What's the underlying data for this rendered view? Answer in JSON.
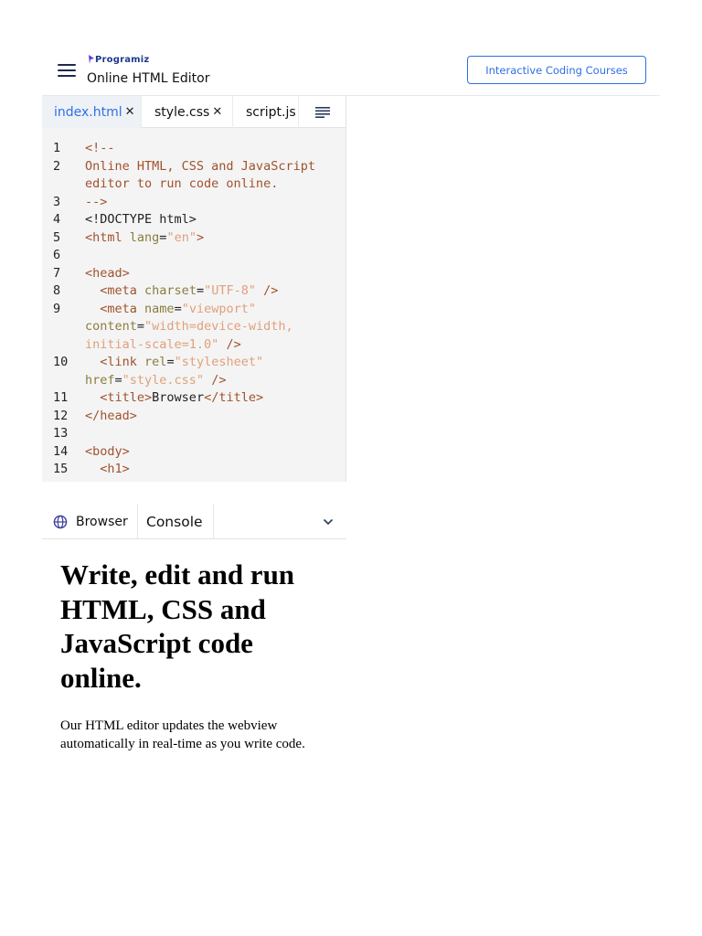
{
  "header": {
    "logo_text": "Programiz",
    "title": "Online HTML Editor",
    "cta_label": "Interactive Coding Courses",
    "menu_icon": "hamburger-menu-icon"
  },
  "editor": {
    "tabs": [
      {
        "label": "index.html",
        "active": true
      },
      {
        "label": "style.css",
        "active": false
      },
      {
        "label": "script.js",
        "active": false
      }
    ],
    "format_icon": "format-lines-icon"
  },
  "output": {
    "browser_label": "Browser",
    "console_label": "Console"
  },
  "preview": {
    "heading": "Write, edit and run HTML, CSS and JavaScript code online.",
    "paragraph": "Our HTML editor updates the webview automatically in real-time as you write code."
  },
  "colors": {
    "accent": "#2f6fe4",
    "code_tag": "#a0522d",
    "code_attr": "#8a7d3e",
    "code_string": "#e0a07a"
  }
}
